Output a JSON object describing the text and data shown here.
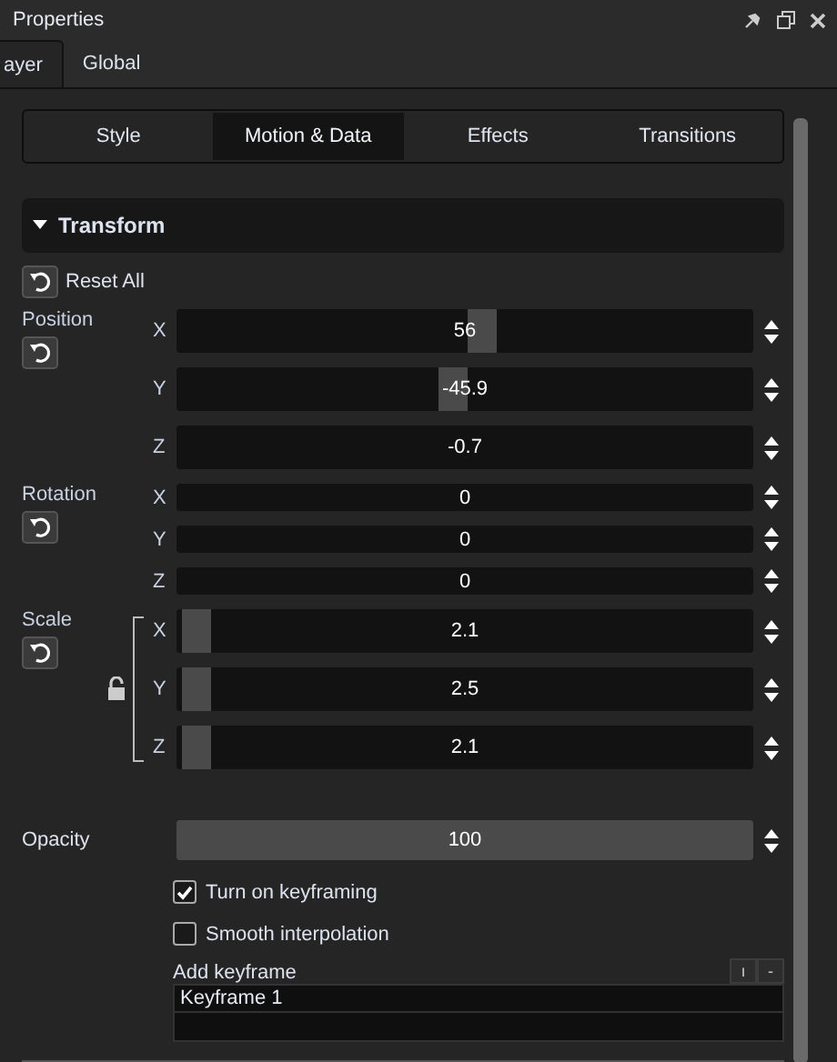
{
  "panel": {
    "title": "Properties"
  },
  "tabs": [
    {
      "label": "ayer",
      "selected": true
    },
    {
      "label": "Global",
      "selected": false
    }
  ],
  "subtabs": [
    {
      "label": "Style",
      "selected": false
    },
    {
      "label": "Motion & Data",
      "selected": true
    },
    {
      "label": "Effects",
      "selected": false
    },
    {
      "label": "Transitions",
      "selected": false
    }
  ],
  "section": {
    "title": "Transform",
    "expanded": true
  },
  "reset_all": "Reset All",
  "groups": [
    {
      "label": "Position",
      "kind": "plain",
      "fields": [
        {
          "axis": "X",
          "value": "56",
          "level": 0.53
        },
        {
          "axis": "Y",
          "value": "-45.9",
          "level": 0.48
        },
        {
          "axis": "Z",
          "value": "-0.7"
        }
      ]
    },
    {
      "label": "Rotation",
      "kind": "plain",
      "fields": [
        {
          "axis": "X",
          "value": "0"
        },
        {
          "axis": "Y",
          "value": "0"
        },
        {
          "axis": "Z",
          "value": "0"
        }
      ]
    },
    {
      "label": "Scale",
      "kind": "linked",
      "fields": [
        {
          "axis": "X",
          "value": "2.1",
          "level": 0.01
        },
        {
          "axis": "Y",
          "value": "2.5",
          "level": 0.01
        },
        {
          "axis": "Z",
          "value": "2.1",
          "level": 0.01
        }
      ]
    }
  ],
  "opacity": {
    "label": "Opacity",
    "value": "100",
    "level": 1
  },
  "options": [
    {
      "label": "Turn on keyframing",
      "checked": true
    },
    {
      "label": "Smooth interpolation",
      "checked": false
    }
  ],
  "keyframes": {
    "label": "Add keyframe",
    "buttons": [
      "ı",
      "-"
    ],
    "items": [
      "Keyframe 1"
    ]
  }
}
